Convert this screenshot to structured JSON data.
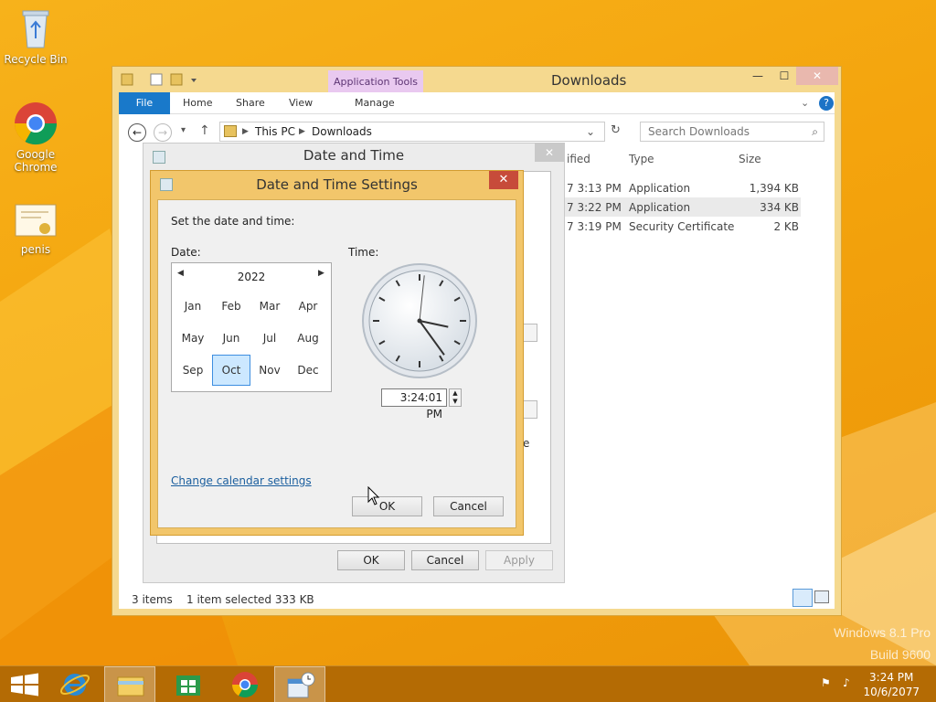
{
  "desktop": {
    "icons": [
      {
        "label": "Recycle Bin"
      },
      {
        "label": "Google Chrome"
      },
      {
        "label": "penis"
      }
    ],
    "watermark": {
      "line1": "Windows 8.1 Pro",
      "line2": "Build 9600"
    }
  },
  "explorer": {
    "title": "Downloads",
    "contextual_tab": "Application Tools",
    "ribbon_tabs": {
      "file": "File",
      "home": "Home",
      "share": "Share",
      "view": "View",
      "manage": "Manage"
    },
    "breadcrumb": {
      "root": "This PC",
      "current": "Downloads"
    },
    "search_placeholder": "Search Downloads",
    "columns": {
      "modified": "ified",
      "type": "Type",
      "size": "Size"
    },
    "rows": [
      {
        "modified": "7 3:13 PM",
        "type": "Application",
        "size": "1,394 KB"
      },
      {
        "modified": "7 3:22 PM",
        "type": "Application",
        "size": "334 KB"
      },
      {
        "modified": "7 3:19 PM",
        "type": "Security Certificate",
        "size": "2 KB"
      }
    ],
    "status": {
      "count": "3 items",
      "selection": "1 item selected  333 KB"
    }
  },
  "date_time_dialog": {
    "title": "Date and Time",
    "ok": "OK",
    "cancel": "Cancel",
    "apply": "Apply",
    "partial_text": "e"
  },
  "settings_dialog": {
    "title": "Date and Time Settings",
    "prompt": "Set the date and time:",
    "date_label": "Date:",
    "time_label": "Time:",
    "calendar": {
      "year": "2022",
      "months": [
        "Jan",
        "Feb",
        "Mar",
        "Apr",
        "May",
        "Jun",
        "Jul",
        "Aug",
        "Sep",
        "Oct",
        "Nov",
        "Dec"
      ],
      "selected_month": "Oct"
    },
    "time_value": "3:24:01 PM",
    "clock_time": {
      "hour": 3,
      "minute": 24,
      "second": 1
    },
    "calendar_link": "Change calendar settings",
    "ok": "OK",
    "cancel": "Cancel",
    "close_glyph": "✕"
  },
  "taskbar": {
    "time": "3:24 PM",
    "date": "10/6/2077"
  },
  "colors": {
    "accent": "#f4a40d",
    "file_tab": "#1979ca",
    "selected_month": "#cce8ff",
    "close_button": "#c74b3a"
  }
}
